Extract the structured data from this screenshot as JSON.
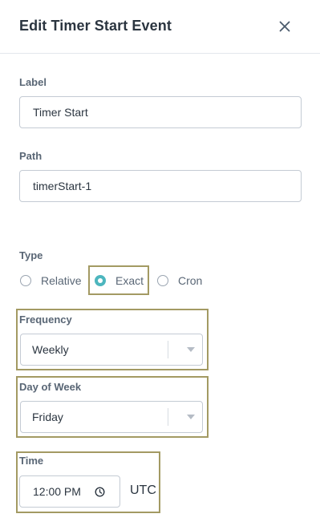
{
  "header": {
    "title": "Edit Timer Start Event",
    "close_icon": "close-icon"
  },
  "label_field": {
    "label": "Label",
    "value": "Timer Start"
  },
  "path_field": {
    "label": "Path",
    "value": "timerStart-1"
  },
  "type": {
    "label": "Type",
    "options": [
      {
        "label": "Relative",
        "checked": false
      },
      {
        "label": "Exact",
        "checked": true
      },
      {
        "label": "Cron",
        "checked": false
      }
    ]
  },
  "frequency": {
    "label": "Frequency",
    "value": "Weekly"
  },
  "day_of_week": {
    "label": "Day of Week",
    "value": "Friday"
  },
  "time": {
    "label": "Time",
    "value": "12:00 PM",
    "timezone": "UTC",
    "icon": "clock-icon"
  },
  "colors": {
    "accent": "#4db6be",
    "highlight_border": "#a39a63",
    "input_border": "#c4cbd4",
    "title_text": "#2b3540",
    "label_text": "#596675"
  }
}
